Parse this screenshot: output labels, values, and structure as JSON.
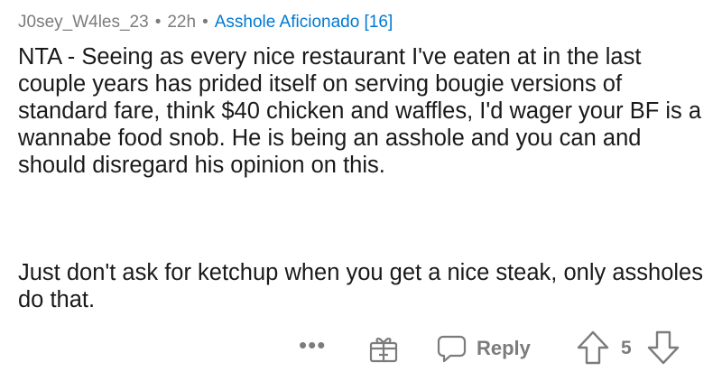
{
  "comment": {
    "author": "J0sey_W4les_23",
    "separator": "•",
    "time": "22h",
    "flair": "Asshole Aficionado [16]",
    "paragraphs": [
      "NTA - Seeing as every nice restaurant I've eaten at in the last couple years has prided itself on serving bougie versions of standard fare, think $40 chicken and waffles, I'd wager your BF is a wannabe food snob. He is being an asshole and you can and should disregard his opinion on this.",
      "Just don't ask for ketchup when you get a nice steak, only assholes do that."
    ]
  },
  "actions": {
    "more": "•••",
    "award_icon": "gift-icon",
    "reply_icon": "speech-bubble-icon",
    "reply_label": "Reply",
    "upvote_icon": "arrow-up-icon",
    "score": "5",
    "downvote_icon": "arrow-down-icon"
  },
  "colors": {
    "meta_text": "#7c7c7c",
    "flair_text": "#0079d3",
    "body_text": "#1a1a1b",
    "icon": "#7c7c7c"
  }
}
